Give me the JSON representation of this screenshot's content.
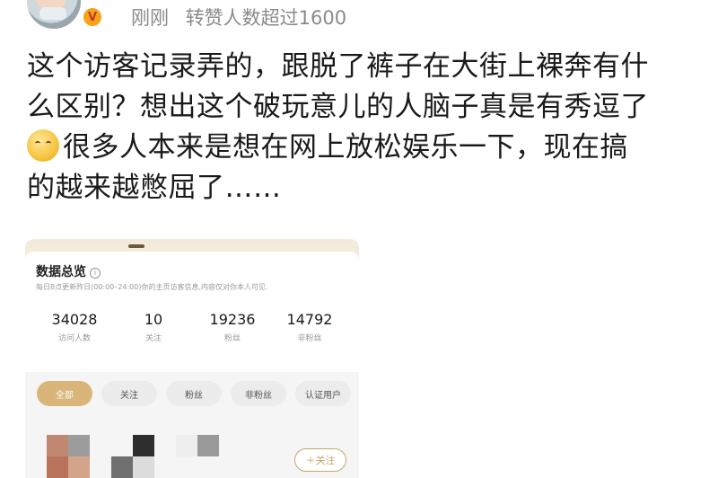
{
  "header": {
    "time": "刚刚",
    "repost_note": "转赞人数超过1600",
    "badge": "V"
  },
  "post": {
    "lines": [
      "这个访客记录弄的，跟脱了裤子在大街上裸奔有什",
      "么区别？想出这个破玩意儿的人脑子真是有秀逗了",
      "很多人本来是想在网上放松娱乐一下，现在搞",
      "的越来越憋屈了……"
    ],
    "emoji_icon": "sleepy-face-emoji"
  },
  "screenshot": {
    "title": "数据总览",
    "subtitle": "每日8点更新昨日(00:00–24:00)你的主页访客信息,内容仅对你本人可见.",
    "stats": [
      {
        "value": "34028",
        "label": "访问人数"
      },
      {
        "value": "10",
        "label": "关注"
      },
      {
        "value": "19236",
        "label": "粉丝"
      },
      {
        "value": "14792",
        "label": "非粉丝"
      }
    ],
    "tabs": [
      "全部",
      "关注",
      "粉丝",
      "非粉丝",
      "认证用户"
    ],
    "follow_label": "＋关注"
  },
  "colors": {
    "accent_gold": "#d9b57a",
    "meta_gray": "#8a8a8a"
  }
}
